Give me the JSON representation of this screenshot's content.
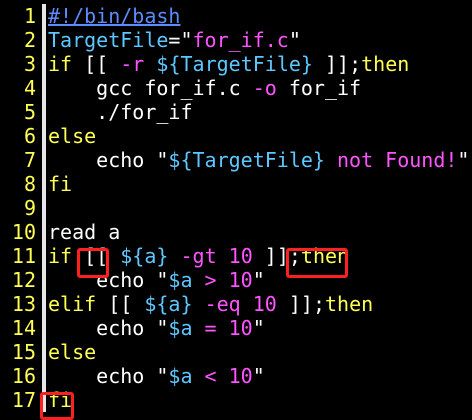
{
  "editor": {
    "colors": {
      "background": "#000000",
      "line_number": "#ffff54",
      "comment": "#5c8cff",
      "variable": "#5cc8ff",
      "string": "#ff54ff",
      "keyword": "#ffff54",
      "number": "#ff54ff",
      "highlight_box": "#ff2020"
    },
    "lines": [
      {
        "number": "1",
        "tokens": [
          {
            "t": "#!/bin/bash",
            "c": "comment"
          }
        ]
      },
      {
        "number": "2",
        "tokens": [
          {
            "t": "TargetFile",
            "c": "var"
          },
          {
            "t": "=",
            "c": "plain"
          },
          {
            "t": "\"",
            "c": "plain"
          },
          {
            "t": "for_if.c",
            "c": "str"
          },
          {
            "t": "\"",
            "c": "plain"
          }
        ]
      },
      {
        "number": "3",
        "tokens": [
          {
            "t": "if",
            "c": "keyword"
          },
          {
            "t": " [[ ",
            "c": "plain"
          },
          {
            "t": "-r",
            "c": "str"
          },
          {
            "t": " ",
            "c": "plain"
          },
          {
            "t": "${TargetFile}",
            "c": "var"
          },
          {
            "t": " ]];",
            "c": "plain"
          },
          {
            "t": "then",
            "c": "keyword"
          }
        ]
      },
      {
        "number": "4",
        "tokens": [
          {
            "t": "    gcc for_if.c ",
            "c": "plain"
          },
          {
            "t": "-o",
            "c": "str"
          },
          {
            "t": " for_if",
            "c": "plain"
          }
        ]
      },
      {
        "number": "5",
        "tokens": [
          {
            "t": "    ./for_if",
            "c": "plain"
          }
        ]
      },
      {
        "number": "6",
        "tokens": [
          {
            "t": "else",
            "c": "keyword"
          }
        ]
      },
      {
        "number": "7",
        "tokens": [
          {
            "t": "    echo ",
            "c": "plain"
          },
          {
            "t": "\"",
            "c": "plain"
          },
          {
            "t": "${TargetFile}",
            "c": "var"
          },
          {
            "t": " not Found!",
            "c": "str"
          },
          {
            "t": "\"",
            "c": "plain"
          }
        ]
      },
      {
        "number": "8",
        "tokens": [
          {
            "t": "fi",
            "c": "keyword"
          }
        ]
      },
      {
        "number": "9",
        "tokens": []
      },
      {
        "number": "10",
        "tokens": [
          {
            "t": "read a",
            "c": "plain"
          }
        ]
      },
      {
        "number": "11",
        "tokens": [
          {
            "t": "if",
            "c": "keyword"
          },
          {
            "t": " [[ ",
            "c": "plain"
          },
          {
            "t": "${a}",
            "c": "var"
          },
          {
            "t": " ",
            "c": "plain"
          },
          {
            "t": "-gt",
            "c": "str"
          },
          {
            "t": " ",
            "c": "plain"
          },
          {
            "t": "10",
            "c": "num"
          },
          {
            "t": " ]];",
            "c": "plain"
          },
          {
            "t": "then",
            "c": "keyword"
          }
        ]
      },
      {
        "number": "12",
        "tokens": [
          {
            "t": "    echo ",
            "c": "plain"
          },
          {
            "t": "\"",
            "c": "plain"
          },
          {
            "t": "$a",
            "c": "var"
          },
          {
            "t": " > 10",
            "c": "str"
          },
          {
            "t": "\"",
            "c": "plain"
          }
        ]
      },
      {
        "number": "13",
        "tokens": [
          {
            "t": "elif",
            "c": "keyword"
          },
          {
            "t": " [[ ",
            "c": "plain"
          },
          {
            "t": "${a}",
            "c": "var"
          },
          {
            "t": " ",
            "c": "plain"
          },
          {
            "t": "-eq",
            "c": "str"
          },
          {
            "t": " ",
            "c": "plain"
          },
          {
            "t": "10",
            "c": "num"
          },
          {
            "t": " ]];",
            "c": "plain"
          },
          {
            "t": "then",
            "c": "keyword"
          }
        ]
      },
      {
        "number": "14",
        "tokens": [
          {
            "t": "    echo ",
            "c": "plain"
          },
          {
            "t": "\"",
            "c": "plain"
          },
          {
            "t": "$a",
            "c": "var"
          },
          {
            "t": " = 10",
            "c": "str"
          },
          {
            "t": "\"",
            "c": "plain"
          }
        ]
      },
      {
        "number": "15",
        "tokens": [
          {
            "t": "else",
            "c": "keyword"
          }
        ]
      },
      {
        "number": "16",
        "tokens": [
          {
            "t": "    echo ",
            "c": "plain"
          },
          {
            "t": "\"",
            "c": "plain"
          },
          {
            "t": "$a",
            "c": "var"
          },
          {
            "t": " < 10",
            "c": "str"
          },
          {
            "t": "\"",
            "c": "plain"
          }
        ]
      },
      {
        "number": "17",
        "tokens": [
          {
            "t": "fi",
            "c": "keyword"
          }
        ]
      }
    ]
  }
}
